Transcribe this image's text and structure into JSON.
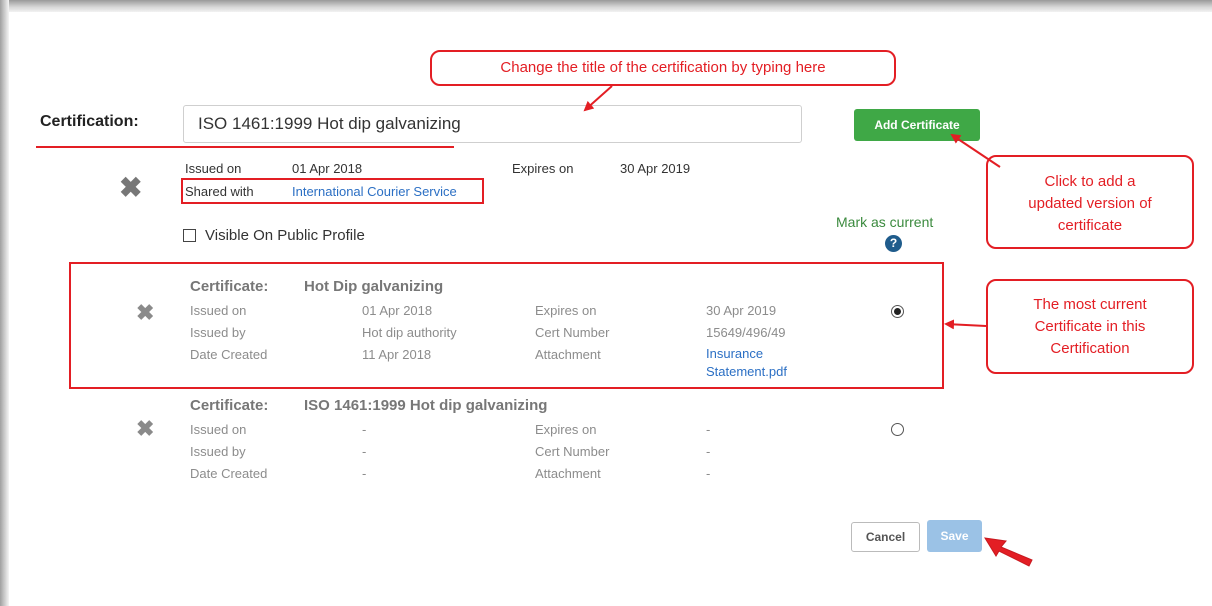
{
  "form": {
    "certification_label": "Certification:",
    "title_value": "ISO 1461:1999 Hot dip galvanizing",
    "add_button": "Add Certificate",
    "issued_on_label": "Issued on",
    "issued_on_value": "01 Apr 2018",
    "expires_on_label": "Expires on",
    "expires_on_value": "30 Apr 2019",
    "shared_with_label": "Shared with",
    "shared_with_value": "International Courier Service",
    "visible_label": "Visible On Public Profile",
    "mark_current_label": "Mark as current",
    "help_glyph": "?"
  },
  "certificates": [
    {
      "label": "Certificate:",
      "name": "Hot Dip galvanizing",
      "issued_on_label": "Issued on",
      "issued_on": "01 Apr 2018",
      "issued_by_label": "Issued by",
      "issued_by": "Hot dip authority",
      "date_created_label": "Date Created",
      "date_created": "11 Apr 2018",
      "expires_on_label": "Expires on",
      "expires_on": "30 Apr 2019",
      "cert_number_label": "Cert Number",
      "cert_number": "15649/496/49",
      "attachment_label": "Attachment",
      "attachment_line1": "Insurance",
      "attachment_line2": "Statement.pdf",
      "selected": true
    },
    {
      "label": "Certificate:",
      "name": "ISO 1461:1999 Hot dip galvanizing",
      "issued_on_label": "Issued on",
      "issued_on": "-",
      "issued_by_label": "Issued by",
      "issued_by": "-",
      "date_created_label": "Date Created",
      "date_created": "-",
      "expires_on_label": "Expires on",
      "expires_on": "-",
      "cert_number_label": "Cert Number",
      "cert_number": "-",
      "attachment_label": "Attachment",
      "attachment": "-",
      "selected": false
    }
  ],
  "actions": {
    "cancel": "Cancel",
    "save": "Save"
  },
  "annotations": {
    "title_hint": "Change the title of the certification by typing here",
    "add_hint_1": "Click to add a",
    "add_hint_2": "updated version of",
    "add_hint_3": "certificate",
    "current_hint_1": "The most current",
    "current_hint_2": "Certificate in this",
    "current_hint_3": "Certification"
  },
  "colors": {
    "annotation_red": "#e31e24",
    "add_button_green": "#3fa846",
    "save_button": "#9bc2e6",
    "link_blue": "#2b6fc4"
  }
}
